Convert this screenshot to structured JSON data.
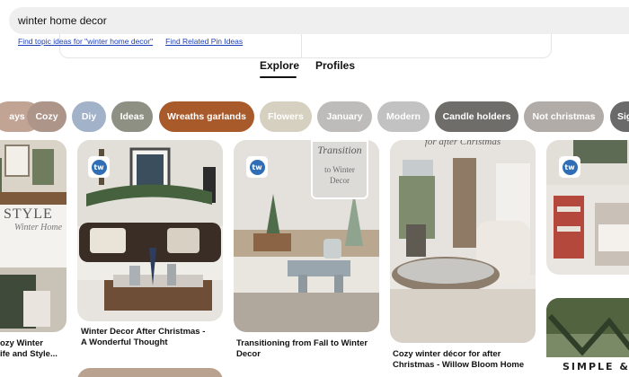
{
  "search": {
    "query": "winter home decor",
    "suggest_topic": "Find topic ideas for \"winter home decor\"",
    "suggest_related": "Find Related Pin Ideas"
  },
  "tabs": [
    {
      "label": "Explore",
      "active": true
    },
    {
      "label": "Profiles",
      "active": false
    }
  ],
  "chips": [
    {
      "label": "ays",
      "color": "#c2a495"
    },
    {
      "label": "Cozy",
      "color": "#ad9589"
    },
    {
      "label": "Diy",
      "color": "#a2b2c8"
    },
    {
      "label": "Ideas",
      "color": "#8e9084"
    },
    {
      "label": "Wreaths garlands",
      "color": "#a85a2a"
    },
    {
      "label": "Flowers",
      "color": "#d5d0bf"
    },
    {
      "label": "January",
      "color": "#bdbcba"
    },
    {
      "label": "Modern",
      "color": "#c2c2c2"
    },
    {
      "label": "Candle holders",
      "color": "#6e6d69"
    },
    {
      "label": "Not christmas",
      "color": "#b1aca7"
    },
    {
      "label": "Sig",
      "color": "#6a6a6a"
    }
  ],
  "pins": {
    "p1": {
      "overlay_1": "STYLE",
      "overlay_2": "Winter Home",
      "caption_1": "ozy Winter",
      "caption_2": "ife and Style..."
    },
    "p2": {
      "badge": "tw",
      "caption_1": "Winter Decor After Christmas -",
      "caption_2": "A Wonderful Thought"
    },
    "p3": {
      "badge": "tw",
      "overlay_1": "Transition",
      "overlay_2": "to Winter",
      "overlay_3": "Decor",
      "caption_1": "Transitioning from Fall to Winter",
      "caption_2": "Decor"
    },
    "p4": {
      "overlay_1": "for after Christmas",
      "caption_1": "Cozy winter décor for after",
      "caption_2": "Christmas - Willow Bloom Home"
    },
    "p5": {
      "badge": "tw"
    },
    "p6": {
      "overlay_1": "SIMPLE &"
    }
  }
}
